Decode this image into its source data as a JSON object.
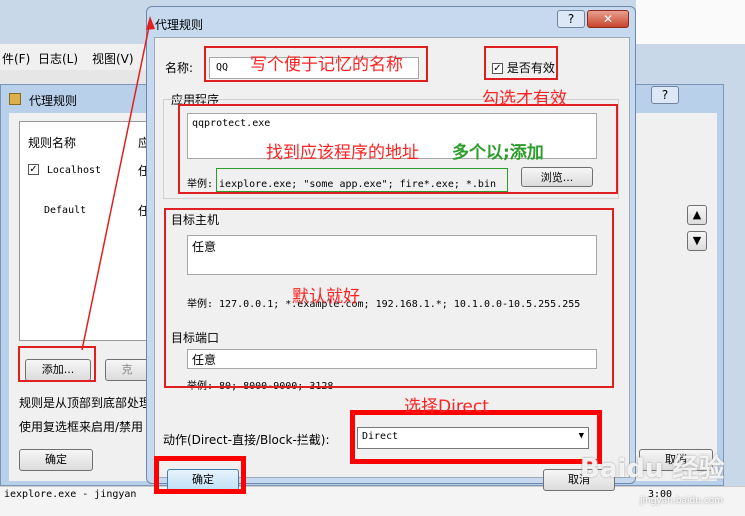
{
  "bg_menu": {
    "items": [
      "件(F)",
      "日志(L)",
      "视图(V)"
    ]
  },
  "parent": {
    "title": "代理规则",
    "col_name": "规则名称",
    "col_app": "应",
    "rows": [
      {
        "name": "Localhost",
        "app": "任",
        "checked": true
      },
      {
        "name": "Default",
        "app": "任",
        "checked": false
      }
    ],
    "add": "添加...",
    "clone": "克",
    "note1": "规则是从顶部到底部处理",
    "note2": "使用复选框来启用/禁用",
    "ok": "确定",
    "cancel": "取消",
    "status": "iexplore.exe - jingyan",
    "status_time": "3:00"
  },
  "dialog": {
    "title": "代理规则",
    "help": "?",
    "close": "✕",
    "name_label": "名称:",
    "name_value": "QQ",
    "enabled_label": "是否有效",
    "app": {
      "legend": "应用程序",
      "value": "qqprotect.exe",
      "example": "举例: iexplore.exe; \"some app.exe\"; fire*.exe; *.bin",
      "browse": "浏览..."
    },
    "host": {
      "legend": "目标主机",
      "value": "任意",
      "example": "举例: 127.0.0.1; *.example.com; 192.168.1.*; 10.1.0.0-10.5.255.255"
    },
    "port": {
      "legend": "目标端口",
      "value": "任意",
      "example": "举例: 80; 8000-9000; 3128"
    },
    "action_label": "动作(Direct-直接/Block-拦截):",
    "action_value": "Direct",
    "ok": "确定",
    "cancel": "取消"
  },
  "annotations": {
    "name": "写个便于记忆的名称",
    "enabled": "勾选才有效",
    "app": "找到应该程序的地址",
    "multi": "多个以;添加",
    "default": "默认就好",
    "direct": "选择Direct"
  },
  "watermark": "Baidu 经验",
  "watermark_url": "jingyan.baidu.com",
  "colors": {
    "annotation": "#ff2222",
    "green": "#2a9d2a",
    "frame": "#8fb1d6"
  }
}
